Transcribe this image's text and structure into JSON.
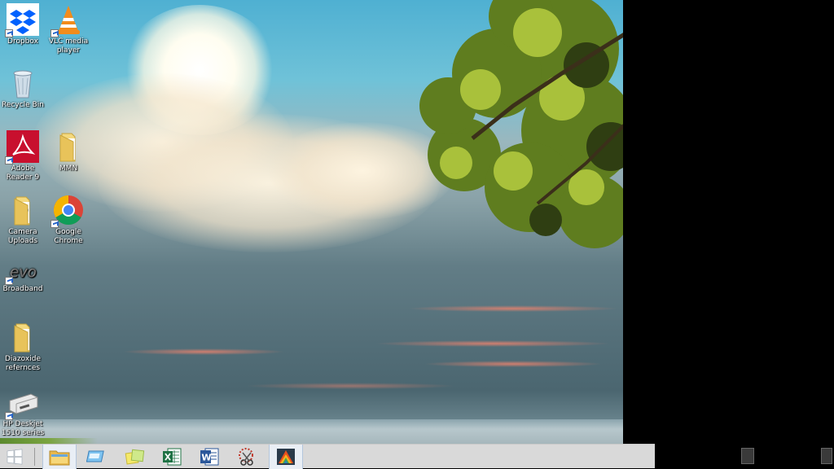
{
  "desktop": {
    "icons": [
      {
        "id": "dropbox",
        "label": "Dropbox",
        "icon": "dropbox-icon"
      },
      {
        "id": "vlc",
        "label": "VLC media player",
        "icon": "vlc-icon"
      },
      {
        "id": "recycle",
        "label": "Recycle Bin",
        "icon": "recycle-bin-icon"
      },
      {
        "id": "adobe",
        "label": "Adobe Reader 9",
        "icon": "adobe-reader-icon"
      },
      {
        "id": "mmn",
        "label": "MMN",
        "icon": "folder-icon"
      },
      {
        "id": "camera",
        "label": "Camera Uploads",
        "icon": "folder-icon"
      },
      {
        "id": "chrome",
        "label": "Google Chrome",
        "icon": "chrome-icon"
      },
      {
        "id": "broadband",
        "label": "Broadband",
        "icon": "evo-icon"
      },
      {
        "id": "diazoxide",
        "label": "Diazoxide refernces",
        "icon": "folder-icon"
      },
      {
        "id": "hp",
        "label": "HP Deskjet 1510 series",
        "icon": "printer-icon"
      }
    ]
  },
  "taskbar": {
    "start_icon": "windows-logo-icon",
    "apps": [
      {
        "name": "File Explorer",
        "icon": "file-explorer-icon",
        "active": true
      },
      {
        "name": "Remote Desktop",
        "icon": "remote-desktop-icon",
        "active": false
      },
      {
        "name": "Sticky Notes",
        "icon": "sticky-notes-icon",
        "active": false
      },
      {
        "name": "Excel",
        "icon": "excel-icon",
        "active": false
      },
      {
        "name": "Word",
        "icon": "word-icon",
        "active": false
      },
      {
        "name": "Snipping Tool",
        "icon": "snipping-tool-icon",
        "active": false
      },
      {
        "name": "AVG",
        "icon": "avg-icon",
        "active": true
      }
    ]
  },
  "colors": {
    "taskbar": "#d9d9d9",
    "excel": "#1f7244",
    "word": "#2b579a",
    "adobe": "#c8102e",
    "dropbox": "#0061fe"
  }
}
